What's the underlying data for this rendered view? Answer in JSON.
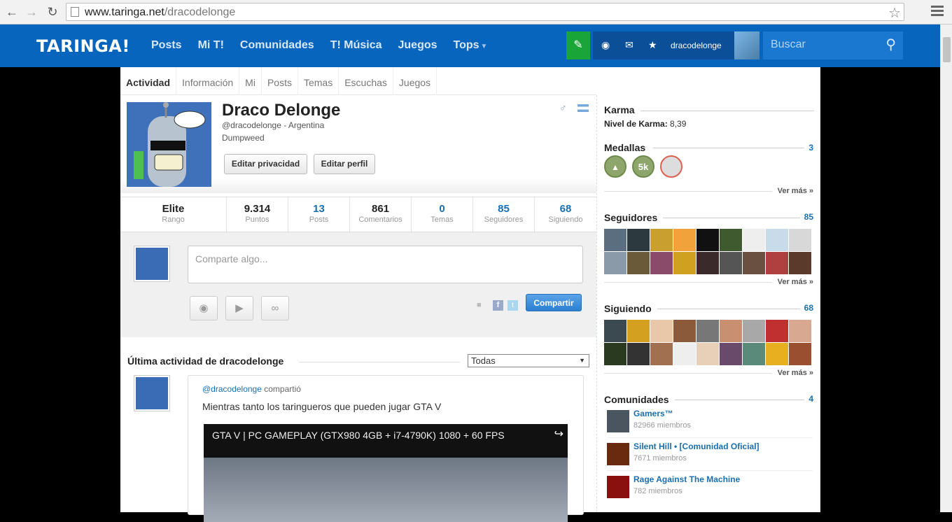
{
  "browser": {
    "url_host": "www.taringa.net",
    "url_path": "/dracodelonge"
  },
  "topbar": {
    "logo": "TARINGA!",
    "nav": [
      "Posts",
      "Mi T!",
      "Comunidades",
      "T! Música",
      "Juegos",
      "Tops"
    ],
    "username": "dracodelonge",
    "search_placeholder": "Buscar",
    "brand_color": "#0765bd"
  },
  "tabs": [
    "Actividad",
    "Información",
    "Mi",
    "Posts",
    "Temas",
    "Escuchas",
    "Juegos"
  ],
  "profile": {
    "name": "Draco Delonge",
    "handle": "@dracodelonge - Argentina",
    "subline": "Dumpweed",
    "edit_privacy": "Editar privacidad",
    "edit_profile": "Editar perfil"
  },
  "stats": [
    {
      "value": "Elite",
      "label": "Rango",
      "blue": false
    },
    {
      "value": "9.314",
      "label": "Puntos",
      "blue": false
    },
    {
      "value": "13",
      "label": "Posts",
      "blue": true
    },
    {
      "value": "861",
      "label": "Comentarios",
      "blue": false
    },
    {
      "value": "0",
      "label": "Temas",
      "blue": true
    },
    {
      "value": "85",
      "label": "Seguidores",
      "blue": true
    },
    {
      "value": "68",
      "label": "Siguiendo",
      "blue": true
    }
  ],
  "composer": {
    "placeholder": "Comparte algo...",
    "share_label": "Compartir"
  },
  "activity": {
    "title": "Última actividad de dracodelonge",
    "filter": "Todas",
    "post_user": "@dracodelonge",
    "post_action": " compartió",
    "post_text": "Mientras tanto los taringueros que pueden jugar GTA V",
    "video_title": "GTA V | PC GAMEPLAY (GTX980 4GB + i7-4790K) 1080 + 60 FPS"
  },
  "sidebar": {
    "karma_title": "Karma",
    "karma_label": "Nivel de Karma:",
    "karma_value": "8,39",
    "medals_title": "Medallas",
    "medals_count": "3",
    "medal_5k": "5k",
    "see_more": "Ver más »",
    "followers_title": "Seguidores",
    "followers_count": "85",
    "following_title": "Siguiendo",
    "following_count": "68",
    "communities_title": "Comunidades",
    "communities_count": "4",
    "communities": [
      {
        "name": "Gamers™",
        "members": "82966 miembros"
      },
      {
        "name": "Silent Hill • [Comunidad Oficial]",
        "members": "7671 miembros"
      },
      {
        "name": "Rage Against The Machine",
        "members": "782 miembros"
      }
    ]
  }
}
